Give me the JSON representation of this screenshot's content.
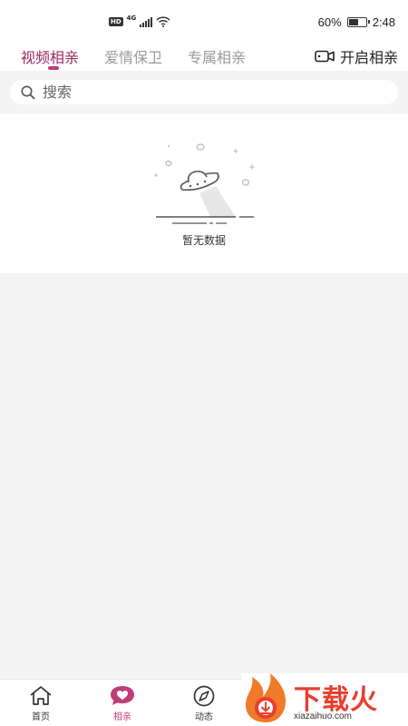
{
  "status_bar": {
    "hd": "HD",
    "network": "4G",
    "battery_percent": "60%",
    "battery_level": 0.6,
    "time": "2:48"
  },
  "tabs": [
    {
      "label": "视频相亲",
      "active": true
    },
    {
      "label": "爱情保卫",
      "active": false
    },
    {
      "label": "专属相亲",
      "active": false
    }
  ],
  "video_button": {
    "label": "开启相亲",
    "icon": "video-camera-icon"
  },
  "search": {
    "placeholder": "搜索",
    "icon": "search-icon"
  },
  "empty_state": {
    "text": "暂无数据",
    "icon": "ufo-icon"
  },
  "bottom_nav": [
    {
      "label": "首页",
      "icon": "home-icon",
      "active": false
    },
    {
      "label": "相亲",
      "icon": "heart-chat-icon",
      "active": true
    },
    {
      "label": "动态",
      "icon": "compass-icon",
      "active": false
    }
  ],
  "watermark": {
    "title": "下载火",
    "subtitle": "xiazaihuo.com"
  },
  "colors": {
    "accent": "#c13b7a",
    "active_tab": "#9b2a63",
    "inactive_tab": "#999999",
    "background": "#f4f4f4",
    "watermark": "#e83e2f"
  }
}
